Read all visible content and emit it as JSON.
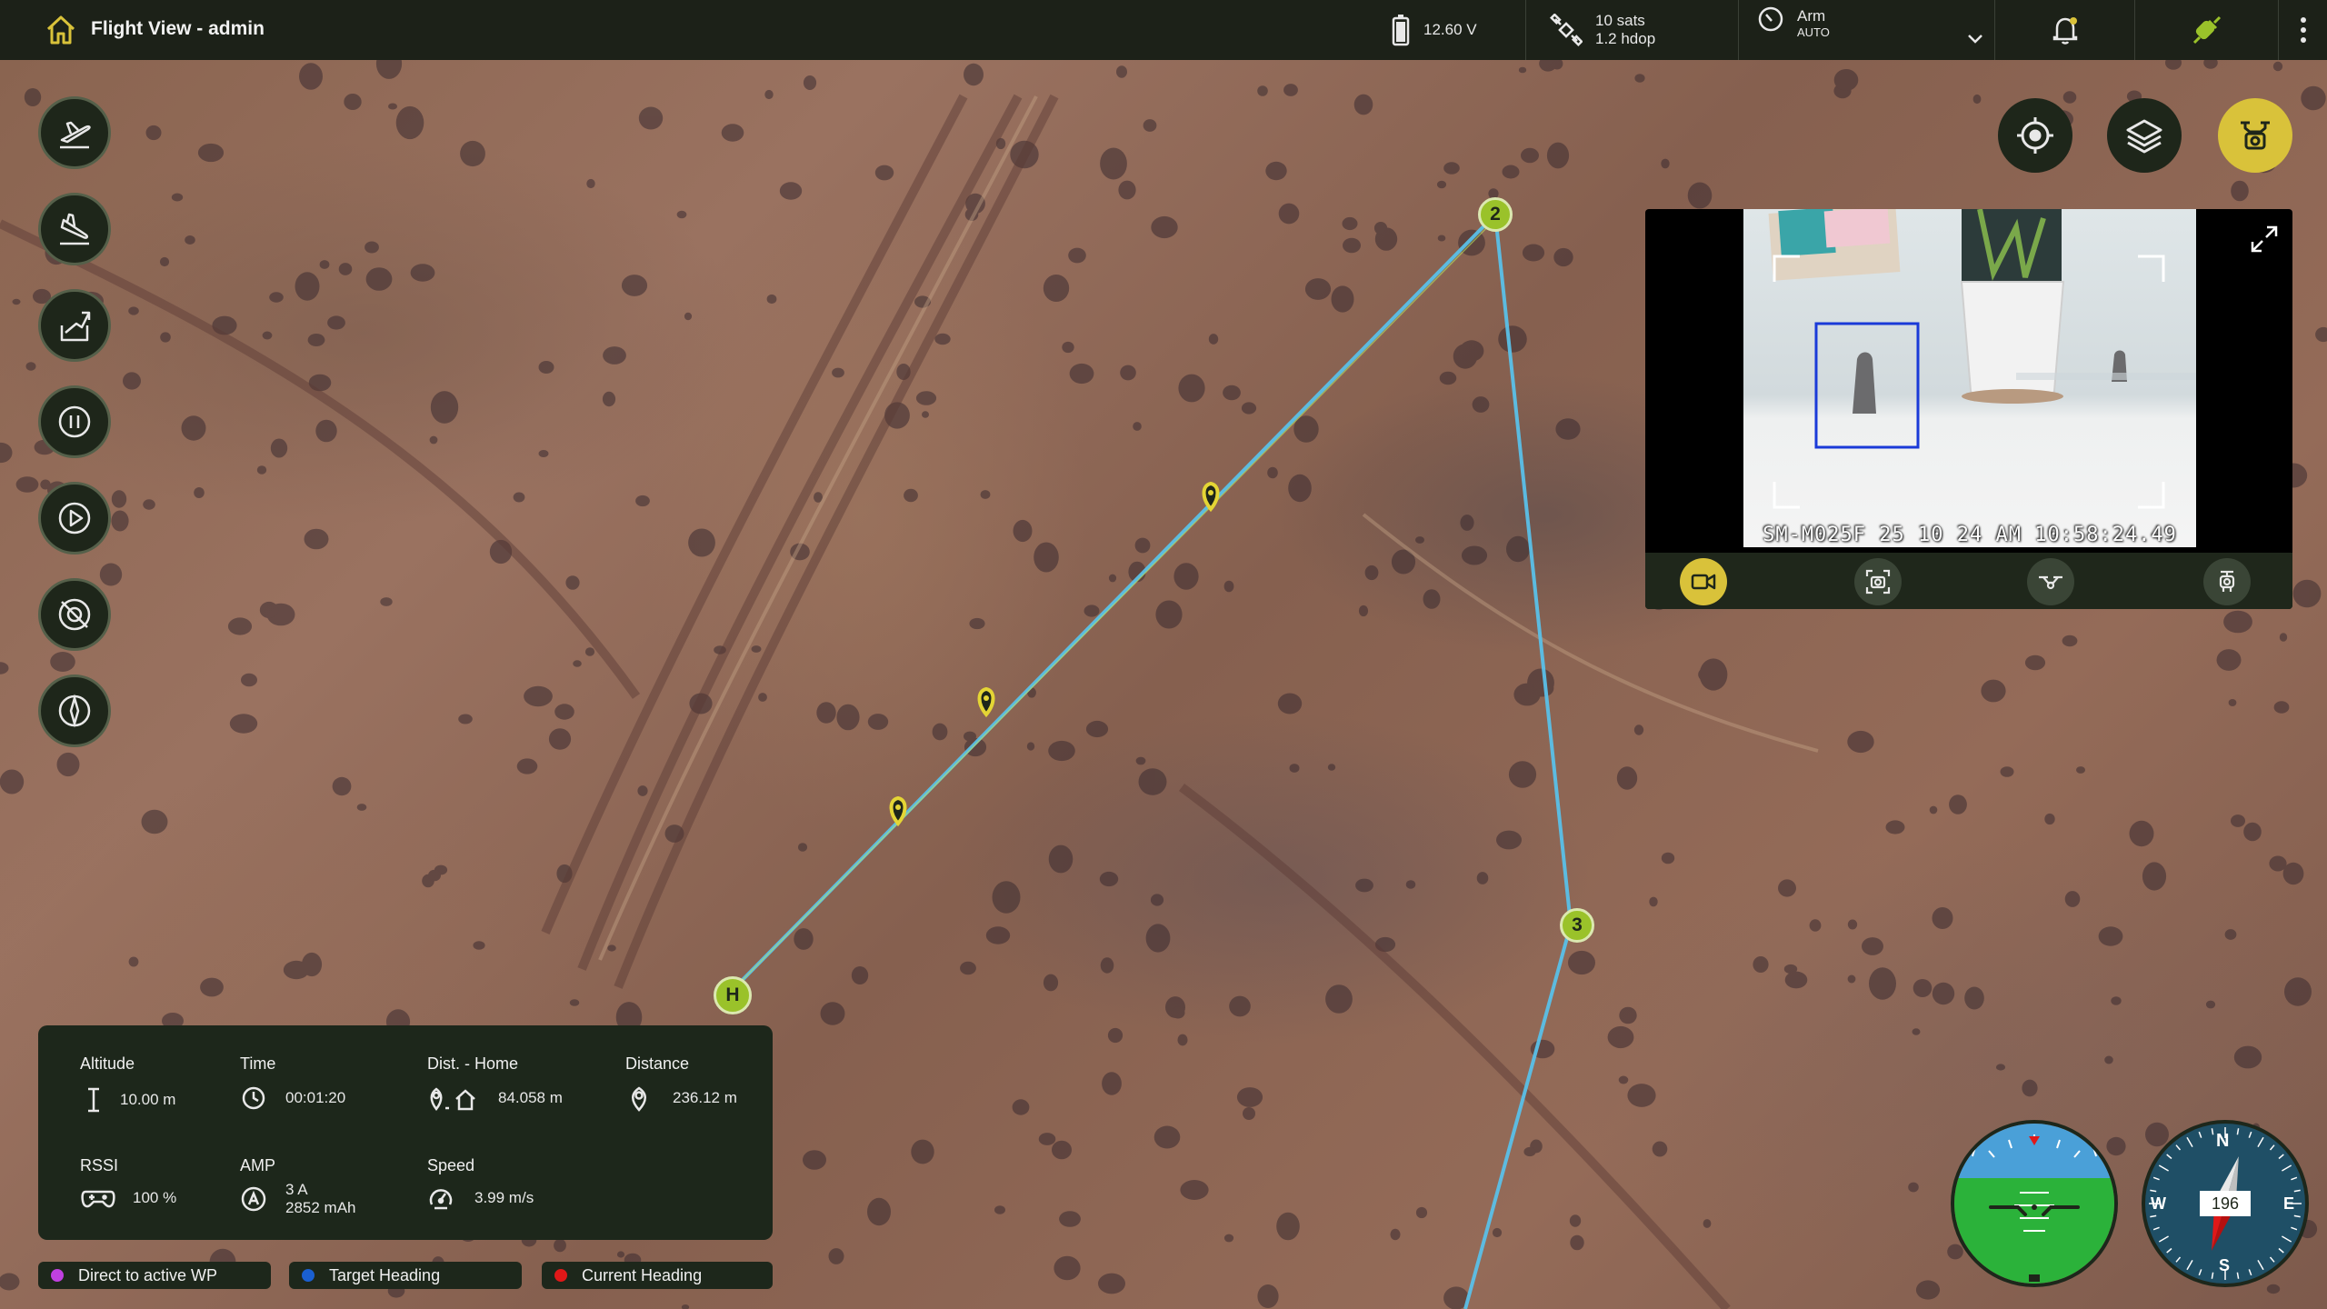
{
  "topbar": {
    "title": "Flight View - admin",
    "battery": "12.60 V",
    "gps_sats": "10 sats",
    "gps_hdop": "1.2 hdop",
    "arm_label": "Arm",
    "arm_mode": "AUTO"
  },
  "left_toolbar": {
    "icons": [
      "takeoff-icon",
      "land-icon",
      "return-home-icon",
      "pause-icon",
      "play-icon",
      "camera-off-icon",
      "compass-calibrate-icon"
    ]
  },
  "right_toolbar": {
    "icons": [
      "target-center-icon",
      "layers-icon",
      "drone-camera-icon"
    ]
  },
  "video": {
    "timestamp": "SM-M025F 25 10 24 AM 10:58:24.49",
    "controls": [
      "video-record-icon",
      "photo-capture-icon",
      "drone-icon",
      "gimbal-icon"
    ]
  },
  "map": {
    "waypoints": [
      "2",
      "3",
      "H"
    ]
  },
  "telemetry": {
    "altitude_label": "Altitude",
    "altitude_value": "10.00 m",
    "time_label": "Time",
    "time_value": "00:01:20",
    "dist_home_label": "Dist. - Home",
    "dist_home_value": "84.058 m",
    "distance_label": "Distance",
    "distance_value": "236.12 m",
    "rssi_label": "RSSI",
    "rssi_value": "100 %",
    "amp_label": "AMP",
    "amp_value": "3 A",
    "amp_capacity": "2852 mAh",
    "speed_label": "Speed",
    "speed_value": "3.99 m/s"
  },
  "legend": {
    "direct_wp": "Direct to active WP",
    "target_heading": "Target Heading",
    "current_heading": "Current Heading",
    "colors": {
      "direct_wp": "#c040e0",
      "target_heading": "#1a5fd0",
      "current_heading": "#e01818"
    }
  },
  "compass": {
    "heading": "196",
    "n": "N",
    "e": "E",
    "s": "S",
    "w": "W"
  },
  "colors": {
    "accent": "#d9c23a",
    "waypoint": "#9ac22a",
    "route": "#5ac0e8",
    "panel": "#1d271b"
  }
}
